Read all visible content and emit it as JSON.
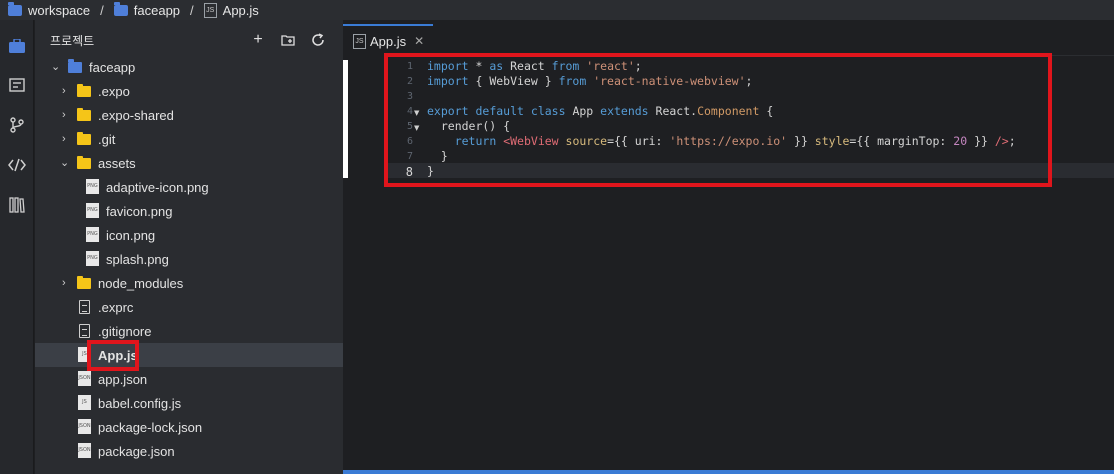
{
  "breadcrumb": {
    "items": [
      {
        "label": "workspace",
        "icon": "folder-blue-icon"
      },
      {
        "label": "faceapp",
        "icon": "folder-blue-icon"
      },
      {
        "label": "App.js",
        "icon": "js-file-icon"
      }
    ],
    "separator": "/"
  },
  "explorer": {
    "title": "프로젝트",
    "actions": [
      "add-icon",
      "new-folder-icon",
      "refresh-icon"
    ],
    "tree": [
      {
        "label": "faceapp",
        "type": "root-folder",
        "expanded": true
      },
      {
        "label": ".expo",
        "type": "folder"
      },
      {
        "label": ".expo-shared",
        "type": "folder"
      },
      {
        "label": ".git",
        "type": "folder"
      },
      {
        "label": "assets",
        "type": "folder",
        "expanded": true
      },
      {
        "label": "adaptive-icon.png",
        "type": "png"
      },
      {
        "label": "favicon.png",
        "type": "png"
      },
      {
        "label": "icon.png",
        "type": "png"
      },
      {
        "label": "splash.png",
        "type": "png"
      },
      {
        "label": "node_modules",
        "type": "folder"
      },
      {
        "label": ".exprc",
        "type": "file"
      },
      {
        "label": ".gitignore",
        "type": "file"
      },
      {
        "label": "App.js",
        "type": "js",
        "selected": true
      },
      {
        "label": "app.json",
        "type": "json"
      },
      {
        "label": "babel.config.js",
        "type": "js"
      },
      {
        "label": "package-lock.json",
        "type": "json"
      },
      {
        "label": "package.json",
        "type": "json"
      }
    ],
    "file_icon_text": {
      "png": "PNG",
      "js": "JS",
      "json": "JSON"
    }
  },
  "editor": {
    "tab_label": "App.js",
    "tab_close": "✕",
    "active_line": 8,
    "line_numbers": [
      "1",
      "2",
      "3",
      "4",
      "5",
      "6",
      "7",
      "8"
    ],
    "code_lines": [
      "import * as React from 'react';",
      "import { WebView } from 'react-native-webview';",
      "",
      "export default class App extends React.Component {",
      "  render() {",
      "    return <WebView source={{ uri: 'https://expo.io' }} style={{ marginTop: 20 }} />;",
      "  }",
      "}"
    ]
  },
  "colors": {
    "annotation": "#e0151c",
    "accent": "#3a7bd5",
    "keyword": "#569cd6",
    "string": "#ce9178"
  }
}
